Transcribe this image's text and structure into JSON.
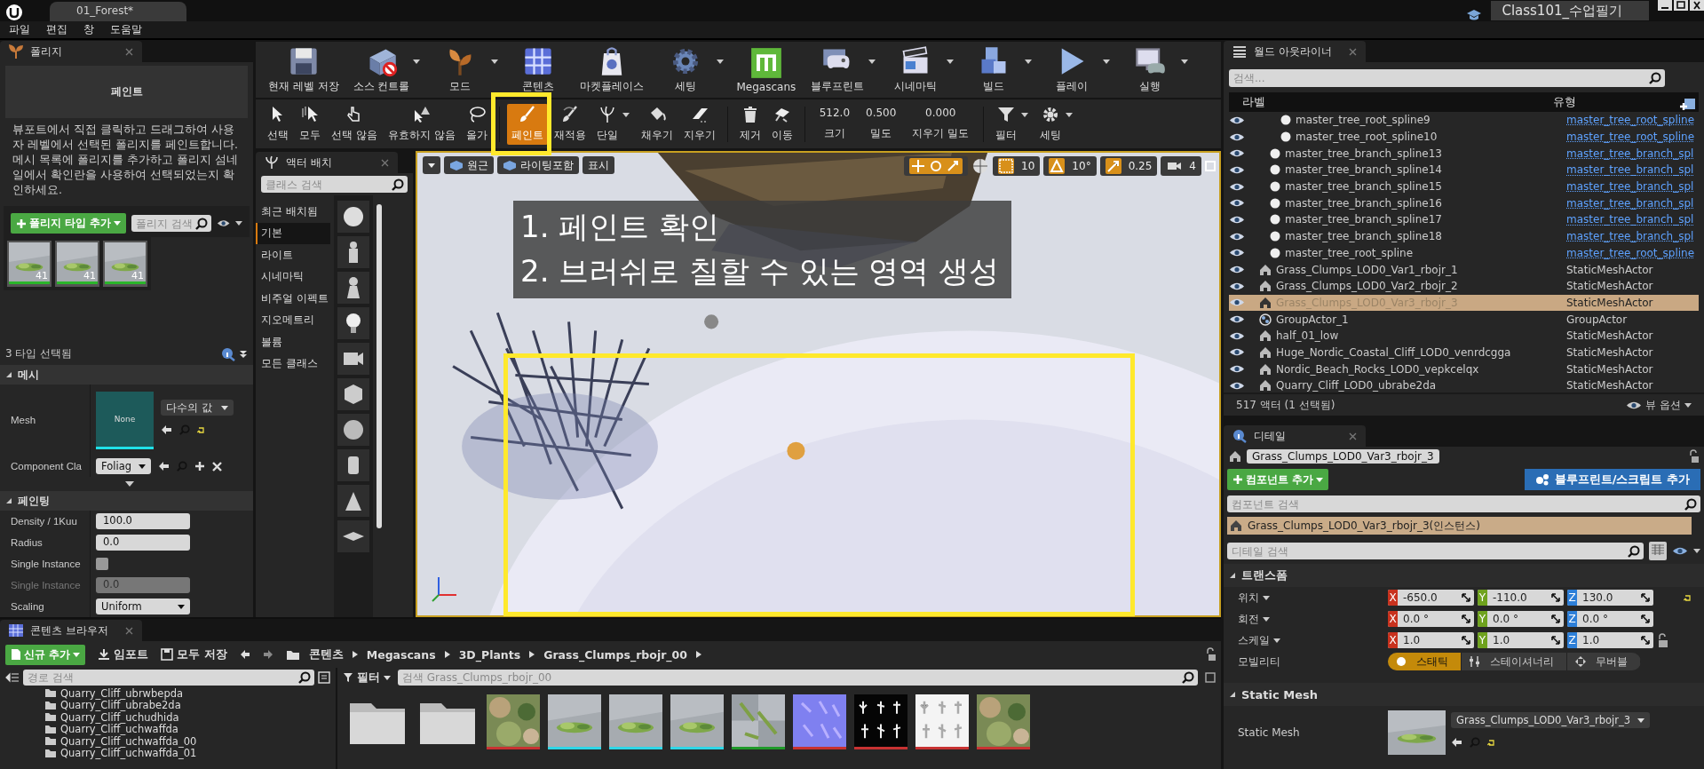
{
  "window": {
    "tab": "01_Forest*",
    "project": "Class101_수업필기"
  },
  "menu": [
    "파일",
    "편집",
    "창",
    "도움말"
  ],
  "foliage": {
    "tab": "폴리지",
    "section": "페인트",
    "description": "뷰포트에서 직접 클릭하고 드래그하여 사용자 레벨에서 선택된 폴리지를 페인트합니다. 메시 목록에 폴리지를 추가하고 폴리지 섬네일에서 확인란을 사용하여 선택되었는지 확인하세요.",
    "add_button": "폴리지 타입 추가",
    "search_placeholder": "폴리지 검색",
    "types": [
      {
        "count": "41",
        "selected": true
      },
      {
        "count": "41",
        "selected": true
      },
      {
        "count": "41",
        "selected": true
      }
    ],
    "selection_count": "3 타입 선택됨",
    "mesh_section": "메시",
    "mesh_label": "Mesh",
    "mesh_thumb": "None",
    "mesh_value": "다수의 값",
    "component_label": "Component Cla",
    "component_value": "Foliag",
    "painting_section": "페인팅",
    "properties": [
      {
        "kind": "text",
        "label": "Density / 1Kuu",
        "value": "100.0",
        "disabled": false
      },
      {
        "kind": "text",
        "label": "Radius",
        "value": "0.0",
        "disabled": false
      },
      {
        "kind": "check",
        "label": "Single Instance",
        "checked": false,
        "disabled": false
      },
      {
        "kind": "text",
        "label": "Single Instance",
        "value": "0.0",
        "disabled": true
      },
      {
        "kind": "select",
        "label": "Scaling",
        "value": "Uniform",
        "disabled": false
      }
    ]
  },
  "toolbar": [
    {
      "label": "현재 레벨 저장",
      "dropdown": false
    },
    {
      "label": "소스 컨트롤",
      "dropdown": true
    },
    {
      "label": "모드",
      "dropdown": true
    },
    {
      "label": "콘텐츠",
      "dropdown": false
    },
    {
      "label": "마켓플레이스",
      "dropdown": false
    },
    {
      "label": "세팅",
      "dropdown": true
    },
    {
      "label": "Megascans",
      "dropdown": false
    },
    {
      "label": "블루프린트",
      "dropdown": true
    },
    {
      "label": "시네마틱",
      "dropdown": true
    },
    {
      "label": "빌드",
      "dropdown": true
    },
    {
      "label": "플레이",
      "dropdown": true
    },
    {
      "label": "실행",
      "dropdown": true
    }
  ],
  "mode_tools": [
    {
      "kind": "tool",
      "label": "선택",
      "selected": false,
      "dropdown": false
    },
    {
      "kind": "tool",
      "label": "모두",
      "selected": false,
      "dropdown": false
    },
    {
      "kind": "tool",
      "label": "선택 않음",
      "selected": false,
      "dropdown": false
    },
    {
      "kind": "tool",
      "label": "유효하지 않음",
      "selected": false,
      "dropdown": false
    },
    {
      "kind": "tool",
      "label": "올가",
      "selected": false,
      "dropdown": false
    },
    {
      "kind": "tool",
      "label": "페인트",
      "selected": true,
      "dropdown": false
    },
    {
      "kind": "tool",
      "label": "재적용",
      "selected": false,
      "dropdown": false
    },
    {
      "kind": "tool",
      "label": "단일",
      "selected": false,
      "dropdown": true
    },
    {
      "kind": "tool",
      "label": "채우기",
      "selected": false,
      "dropdown": false
    },
    {
      "kind": "tool",
      "label": "지우기",
      "selected": false,
      "dropdown": false
    },
    {
      "kind": "tool",
      "label": "제거",
      "selected": false,
      "dropdown": false
    },
    {
      "kind": "tool",
      "label": "이동",
      "selected": false,
      "dropdown": false
    },
    {
      "kind": "value",
      "value": "512.0",
      "label": "크기"
    },
    {
      "kind": "value",
      "value": "0.500",
      "label": "밀도"
    },
    {
      "kind": "value",
      "value": "0.000",
      "label": "지우기 밀도"
    },
    {
      "kind": "tool",
      "label": "필터",
      "selected": false,
      "dropdown": true
    },
    {
      "kind": "tool",
      "label": "세팅",
      "selected": false,
      "dropdown": true
    }
  ],
  "place_actors": {
    "tab": "액터 배치",
    "search_placeholder": "클래스 검색",
    "categories": [
      {
        "label": "최근 배치됨",
        "selected": false
      },
      {
        "label": "기본",
        "selected": true
      },
      {
        "label": "라이트",
        "selected": false
      },
      {
        "label": "시네마틱",
        "selected": false
      },
      {
        "label": "비주얼 이펙트",
        "selected": false
      },
      {
        "label": "지오메트리",
        "selected": false
      },
      {
        "label": "볼륨",
        "selected": false
      },
      {
        "label": "모든 클래스",
        "selected": false
      }
    ]
  },
  "viewport": {
    "view_buttons": [
      "원근",
      "라이팅포함",
      "표시"
    ],
    "snaps": [
      {
        "value": "10",
        "on": true
      },
      {
        "value": "10°",
        "on": true
      },
      {
        "value": "0.25",
        "on": true
      },
      {
        "value": "4",
        "on": false
      }
    ],
    "notes": [
      "1. 페인트 확인",
      "2. 브러쉬로 칠할 수 있는 영역 생성"
    ]
  },
  "outliner": {
    "tab": "월드 아웃라이너",
    "search_placeholder": "검색...",
    "columns": [
      "라벨",
      "유형"
    ],
    "rows": [
      {
        "children": [
          {
            "children": [
              {
                "label": "master_tree_root_spline9",
                "type": "master_tree_root_spline",
                "kind": "spline",
                "selected": false
              },
              {
                "label": "master_tree_root_spline10",
                "type": "master_tree_root_spline",
                "kind": "spline",
                "selected": false
              }
            ]
          },
          {
            "label": "master_tree_branch_spline13",
            "type": "master_tree_branch_spl",
            "kind": "spline",
            "selected": false
          },
          {
            "label": "master_tree_branch_spline14",
            "type": "master_tree_branch_spl",
            "kind": "spline",
            "selected": false
          },
          {
            "label": "master_tree_branch_spline15",
            "type": "master_tree_branch_spl",
            "kind": "spline",
            "selected": false
          },
          {
            "label": "master_tree_branch_spline16",
            "type": "master_tree_branch_spl",
            "kind": "spline",
            "selected": false
          },
          {
            "label": "master_tree_branch_spline17",
            "type": "master_tree_branch_spl",
            "kind": "spline",
            "selected": false
          },
          {
            "label": "master_tree_branch_spline18",
            "type": "master_tree_branch_spl",
            "kind": "spline",
            "selected": false
          },
          {
            "label": "master_tree_root_spline",
            "type": "master_tree_root_spline",
            "kind": "spline",
            "selected": false
          }
        ]
      },
      {
        "label": "Grass_Clumps_LOD0_Var1_rbojr_1",
        "type": "StaticMeshActor",
        "kind": "mesh",
        "selected": false
      },
      {
        "label": "Grass_Clumps_LOD0_Var2_rbojr_2",
        "type": "StaticMeshActor",
        "kind": "mesh",
        "selected": false
      },
      {
        "label": "Grass_Clumps_LOD0_Var3_rbojr_3",
        "type": "StaticMeshActor",
        "kind": "mesh",
        "selected": true
      },
      {
        "label": "GroupActor_1",
        "type": "GroupActor",
        "kind": "group",
        "selected": false
      },
      {
        "label": "half_01_low",
        "type": "StaticMeshActor",
        "kind": "mesh",
        "selected": false
      },
      {
        "label": "Huge_Nordic_Coastal_Cliff_LOD0_venrdcgga",
        "type": "StaticMeshActor",
        "kind": "mesh",
        "selected": false
      },
      {
        "label": "Nordic_Beach_Rocks_LOD0_vepkcelqx",
        "type": "StaticMeshActor",
        "kind": "mesh",
        "selected": false
      },
      {
        "label": "Quarry_Cliff_LOD0_ubrabe2da",
        "type": "StaticMeshActor",
        "kind": "mesh",
        "selected": false
      }
    ],
    "status": "517 액터 (1 선택됨)",
    "view_options": "뷰 옵션"
  },
  "details": {
    "tab": "디테일",
    "actor_name": "Grass_Clumps_LOD0_Var3_rbojr_3",
    "add_component": "컴포넌트 추가",
    "add_script": "블루프린트/스크립트 추가",
    "component_search_placeholder": "컴포넌트 검색",
    "component": "Grass_Clumps_LOD0_Var3_rbojr_3(인스턴스)",
    "detail_search_placeholder": "디테일 검색",
    "transform_section": "트랜스폼",
    "transform": [
      {
        "label": "위치",
        "modified": true,
        "values": [
          {
            "axis": "X",
            "value": "-650.0"
          },
          {
            "axis": "Y",
            "value": "-110.0"
          },
          {
            "axis": "Z",
            "value": "130.0"
          }
        ]
      },
      {
        "label": "회전",
        "modified": false,
        "values": [
          {
            "axis": "X",
            "value": "0.0 °"
          },
          {
            "axis": "Y",
            "value": "0.0 °"
          },
          {
            "axis": "Z",
            "value": "0.0 °"
          }
        ]
      },
      {
        "label": "스케일",
        "modified": false,
        "ratio_locked": false,
        "values": [
          {
            "axis": "X",
            "value": "1.0"
          },
          {
            "axis": "Y",
            "value": "1.0"
          },
          {
            "axis": "Z",
            "value": "1.0"
          }
        ]
      }
    ],
    "mobility_label": "모빌리티",
    "mobility": [
      {
        "label": "스태틱",
        "selected": true
      },
      {
        "label": "스테이셔너리",
        "selected": false
      },
      {
        "label": "무버블",
        "selected": false
      }
    ],
    "mesh_section": "Static Mesh",
    "mesh_label": "Static Mesh",
    "mesh_value": "Grass_Clumps_LOD0_Var3_rbojr_3"
  },
  "content_browser": {
    "tab": "콘텐츠 브라우저",
    "add_new": "신규 추가",
    "import": "임포트",
    "save_all": "모두 저장",
    "path": [
      "콘텐츠",
      "Megascans",
      "3D_Plants",
      "Grass_Clumps_rbojr_00"
    ],
    "path_search_placeholder": "경로 검색",
    "folders": [
      "Quarry_Cliff_ubrwbepda",
      "Quarry_Cliff_ubrabe2da",
      "Quarry_Cliff_uchudhida",
      "Quarry_Cliff_uchwaffda",
      "Quarry_Cliff_uchwaffda_00",
      "Quarry_Cliff_uchwaffda_01"
    ],
    "filter": "필터",
    "asset_search_placeholder": "검색 Grass_Clumps_rbojr_00",
    "assets": [
      {
        "kind": "folder"
      },
      {
        "kind": "folder"
      },
      {
        "kind": "asset",
        "color": "#c83232"
      },
      {
        "kind": "asset",
        "color": "#2fd6e6"
      },
      {
        "kind": "asset",
        "color": "#2fd6e6"
      },
      {
        "kind": "asset",
        "color": "#2fd6e6"
      },
      {
        "kind": "asset",
        "color": "#1f9a2a"
      },
      {
        "kind": "asset",
        "color": "#c83232"
      },
      {
        "kind": "asset",
        "color": "#c83232"
      },
      {
        "kind": "asset",
        "color": "#c83232"
      },
      {
        "kind": "asset",
        "color": "#c83232"
      }
    ]
  }
}
